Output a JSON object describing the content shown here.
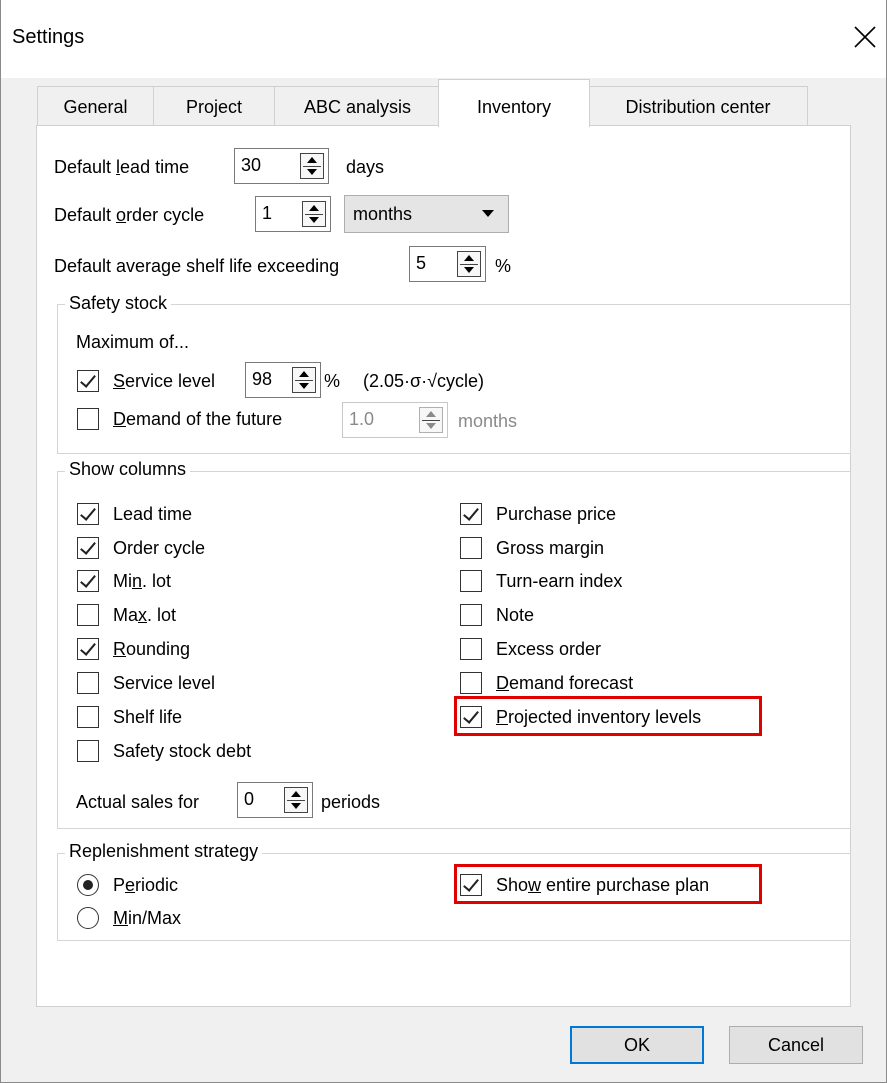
{
  "window": {
    "title": "Settings"
  },
  "tabs": [
    {
      "label": "General"
    },
    {
      "label": "Project"
    },
    {
      "label": "ABC analysis"
    },
    {
      "label": "Inventory"
    },
    {
      "label": "Distribution center"
    }
  ],
  "active_tab": "Inventory",
  "inventory": {
    "lead_time": {
      "pre": "Default ",
      "key": "l",
      "post": "ead time",
      "value": "30",
      "unit": "days"
    },
    "order_cycle": {
      "pre": "Default ",
      "key": "o",
      "post": "rder cycle",
      "value": "1",
      "unit": "months"
    },
    "shelf_life": {
      "label": "Default average shelf life exceeding",
      "value": "5",
      "unit": "%"
    }
  },
  "safety_stock": {
    "title": "Safety stock",
    "subtitle": "Maximum of...",
    "service_level": {
      "key": "S",
      "rest": "ervice level",
      "checked": true,
      "value": "98",
      "unit": "%",
      "formula": "(2.05·σ·√cycle)"
    },
    "demand_future": {
      "key": "D",
      "rest": "emand of the future",
      "checked": false,
      "value": "1.0",
      "unit": "months"
    }
  },
  "show_columns": {
    "title": "Show columns",
    "left": [
      {
        "pre": "",
        "key": "",
        "post": "Lead time",
        "checked": true
      },
      {
        "pre": "",
        "key": "",
        "post": "Order cycle",
        "checked": true
      },
      {
        "pre": "Mi",
        "key": "n",
        "post": ". lot",
        "checked": true
      },
      {
        "pre": "Ma",
        "key": "x",
        "post": ". lot",
        "checked": false
      },
      {
        "pre": "",
        "key": "R",
        "post": "ounding",
        "checked": true
      },
      {
        "pre": "",
        "key": "",
        "post": "Service level",
        "checked": false
      },
      {
        "pre": "",
        "key": "",
        "post": "Shelf life",
        "checked": false
      },
      {
        "pre": "",
        "key": "",
        "post": "Safety stock debt",
        "checked": false
      }
    ],
    "right": [
      {
        "pre": "",
        "key": "",
        "post": "Purchase price",
        "checked": true
      },
      {
        "pre": "",
        "key": "",
        "post": "Gross margin",
        "checked": false
      },
      {
        "pre": "",
        "key": "",
        "post": "Turn-earn index",
        "checked": false
      },
      {
        "pre": "",
        "key": "",
        "post": "Note",
        "checked": false
      },
      {
        "pre": "",
        "key": "",
        "post": "Excess order",
        "checked": false
      },
      {
        "pre": "",
        "key": "D",
        "post": "emand forecast",
        "checked": false
      },
      {
        "pre": "",
        "key": "P",
        "post": "rojected inventory levels",
        "checked": true
      }
    ],
    "actual_sales": {
      "label": "Actual sales for",
      "value": "0",
      "unit": "periods"
    }
  },
  "replenishment": {
    "title": "Replenishment strategy",
    "periodic": {
      "pre": "P",
      "key": "e",
      "post": "riodic",
      "selected": true
    },
    "minmax": {
      "pre": "",
      "key": "M",
      "post": "in/Max",
      "selected": false
    },
    "show_plan": {
      "pre": "Sho",
      "key": "w",
      "post": " entire purchase plan",
      "checked": true
    }
  },
  "buttons": {
    "ok": "OK",
    "cancel": "Cancel"
  },
  "colors": {
    "highlight": "#e00000",
    "default_button_border": "#0078d7"
  }
}
